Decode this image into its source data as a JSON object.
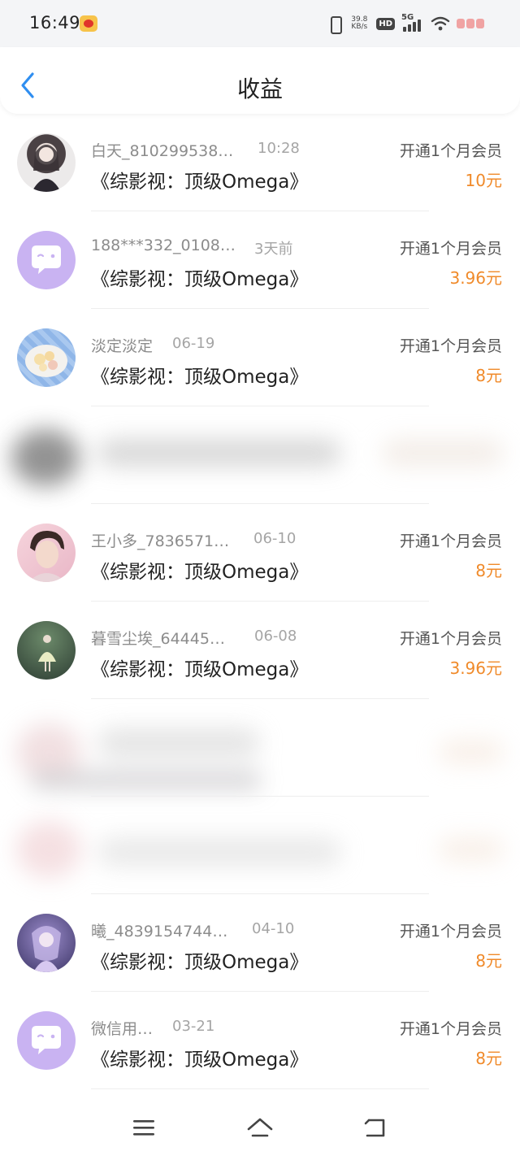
{
  "status_bar": {
    "time": "16:49",
    "net_speed_value": "39.8",
    "net_speed_unit": "KB/s",
    "hd_badge": "HD",
    "network": "5G",
    "icons": [
      "weibo-icon",
      "vibrate-icon",
      "signal-icon",
      "wifi-icon",
      "battery-icon"
    ]
  },
  "header": {
    "title": "收益",
    "back_icon": "chevron-left-icon"
  },
  "items": [
    {
      "user": "白天_810299538…",
      "time": "10:28",
      "title": "《综影视：顶级Omega》",
      "action": "开通1个月会员",
      "amount": "10元",
      "avatar": "photo-girl-dark-dress"
    },
    {
      "user": "188***332_0108…",
      "time": "3天前",
      "title": "《综影视：顶级Omega》",
      "action": "开通1个月会员",
      "amount": "3.96元",
      "avatar": "default-chat-bubble"
    },
    {
      "user": "淡定淡定",
      "time": "06-19",
      "title": "《综影视：顶级Omega》",
      "action": "开通1个月会员",
      "amount": "8元",
      "avatar": "photo-fruit-plate"
    },
    {
      "user": "",
      "time": "",
      "title": "",
      "action": "",
      "amount": "",
      "avatar": "blurred"
    },
    {
      "user": "王小多_7836571…",
      "time": "06-10",
      "title": "《综影视：顶级Omega》",
      "action": "开通1个月会员",
      "amount": "8元",
      "avatar": "photo-young-man"
    },
    {
      "user": "暮雪尘埃_64445…",
      "time": "06-08",
      "title": "《综影视：顶级Omega》",
      "action": "开通1个月会员",
      "amount": "3.96元",
      "avatar": "photo-girl-forest"
    },
    {
      "user": "",
      "time": "",
      "title": "",
      "action": "",
      "amount": "",
      "avatar": "blurred"
    },
    {
      "user": "",
      "time": "",
      "title": "",
      "action": "",
      "amount": "",
      "avatar": "blurred"
    },
    {
      "user": "曦_4839154744…",
      "time": "04-10",
      "title": "《综影视：顶级Omega》",
      "action": "开通1个月会员",
      "amount": "8元",
      "avatar": "photo-anime-purple"
    },
    {
      "user": "微信用…",
      "time": "03-21",
      "title": "《综影视：顶级Omega》",
      "action": "开通1个月会员",
      "amount": "8元",
      "avatar": "default-chat-bubble"
    }
  ],
  "bottom_nav": {
    "icons": [
      "menu-icon",
      "home-icon",
      "return-icon"
    ]
  },
  "colors": {
    "accent_blue": "#2f8ef0",
    "amount_orange": "#f08a2a",
    "default_avatar_purple": "#c9b3f2"
  }
}
